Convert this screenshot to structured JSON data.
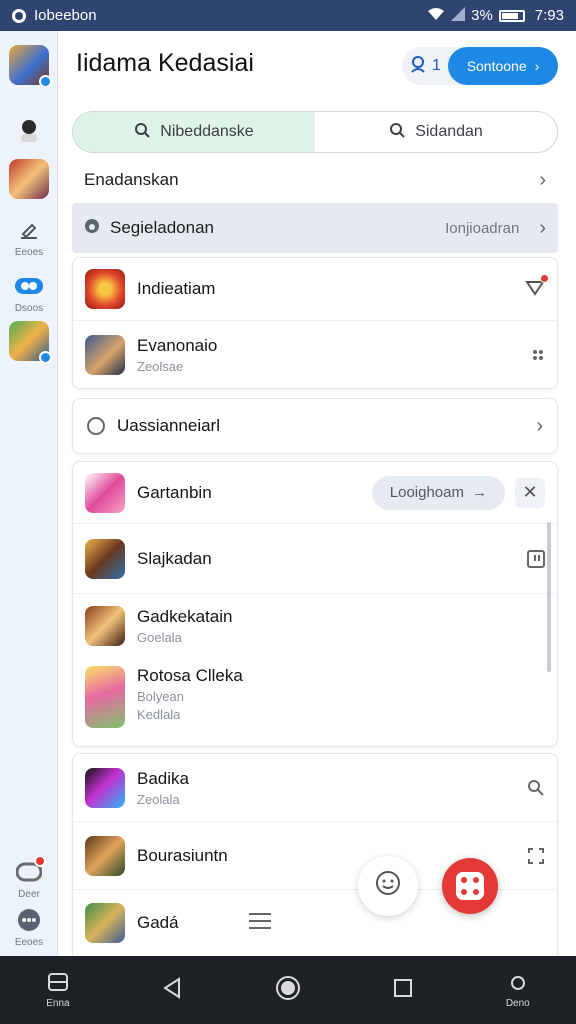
{
  "status_bar": {
    "left_text": "Iobeebon",
    "right_text": "3%",
    "time": "7:93"
  },
  "side_rail": {
    "items": [
      {
        "label": ""
      },
      {
        "label": ""
      },
      {
        "label": ""
      },
      {
        "label": "Eeoes"
      },
      {
        "label": "Dsoos"
      },
      {
        "label": ""
      },
      {
        "label": "Deer"
      },
      {
        "label": "Eeoes"
      }
    ]
  },
  "header": {
    "title": "Iidama Kedasiai",
    "user_count": "1",
    "cta_label": "Sontoone"
  },
  "segmented": {
    "left_label": "Nibeddanske",
    "right_label": "Sidandan"
  },
  "section_header": {
    "label": "Enadanskan"
  },
  "filter_row": {
    "label": "Segieladonan",
    "value": "Ionjioadran"
  },
  "card1": [
    {
      "title": "Indieatiam"
    },
    {
      "title": "Evanonaio",
      "subtitle": "Zeolsae"
    }
  ],
  "radio_row": {
    "label": "Uassianneiarl"
  },
  "card2": {
    "first": {
      "title": "Gartanbin",
      "pill_label": "Looighoam"
    },
    "items": [
      {
        "title": "Slajkadan"
      },
      {
        "title": "Gadkekatain",
        "subtitle": "Goelala"
      },
      {
        "title": "Rotosa Clleka",
        "subtitle": "Bolyean",
        "subtitle2": "Kedlala"
      }
    ]
  },
  "card3": [
    {
      "title": "Badika",
      "subtitle": "Zeolala"
    },
    {
      "title": "Bourasiuntn"
    },
    {
      "title": "Gadá"
    }
  ],
  "nav_bar": {
    "left_label": "Enna",
    "right_label": "Deno"
  },
  "colors": {
    "accent": "#1e88e5",
    "fab_red": "#e53935",
    "status_bar": "#2f4470",
    "segment_active": "#dff3e6"
  }
}
